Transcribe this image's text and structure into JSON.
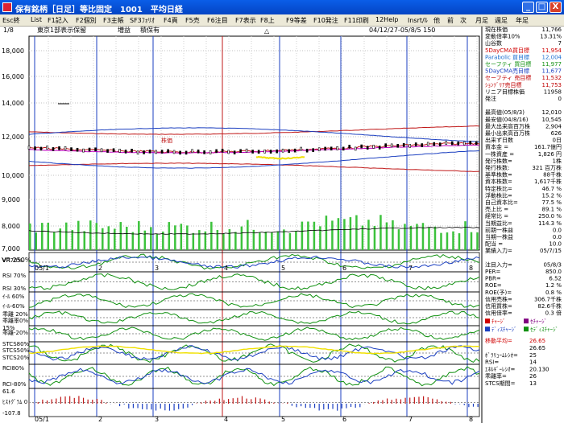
{
  "window": {
    "title": "保有銘柄［日足］等比固定　1001　平均日経",
    "minimize_label": "_",
    "maximize_label": "□",
    "close_label": "X"
  },
  "menu": [
    "Esc終",
    "List",
    "F1記入",
    "F2個別",
    "F3主帳",
    "SF3ﾌｫﾘｵ",
    "F4頁",
    "F5売",
    "F6注目",
    "F7表示",
    "F8上",
    "F9等差",
    "F10発注",
    "F11印刷",
    "12Help",
    "Insrt/ﾙ",
    "他",
    "前",
    "次",
    "月足",
    "週足",
    "年足"
  ],
  "header": {
    "page": "1/8",
    "section": "東京1部表示保留",
    "tag1": "増益",
    "tag2": "積保有",
    "marker": "△",
    "date_range": "04/12/27-05/8/5 150"
  },
  "price_axis": [
    "18,000",
    "16,000",
    "14,000",
    "12,000",
    "10,000",
    "9,000",
    "8,000",
    "7,000"
  ],
  "vr_label": "VR 250%",
  "x_labels": [
    "05/1",
    "2",
    "3",
    "4",
    "5",
    "6",
    "7",
    "8"
  ],
  "ma_label": "5DayCMA",
  "chart_annotation": "株価",
  "indicators": {
    "vr": "VR70%",
    "rsi": [
      "RSI 70%",
      "RSI 30%"
    ],
    "ie": [
      "ｲ-ﾙ 60%",
      "ｲ-ﾙ-60%"
    ],
    "kairi": [
      "乖離 20%",
      "乖離率0%"
    ],
    "kairi2": [
      "乖離-20%",
      "15%"
    ],
    "stcs": [
      "STCS80%",
      "STCS50%",
      "STCS20%"
    ],
    "rci": [
      "RCI80%",
      "RCI-80%"
    ],
    "hist": [
      "61.6",
      "ﾋｽﾄｸﾞﾗﾑ 0",
      "-107.8"
    ]
  },
  "info_panel": [
    {
      "label": "現在株価",
      "value": "11,766",
      "color": "#000000"
    },
    {
      "label": "変動倍率10%",
      "value": "13.31%",
      "color": "#000000"
    },
    {
      "label": "山谷数",
      "value": "7",
      "color": "#000000"
    },
    {
      "label": "5DayCMA買目標",
      "value": "11,954",
      "color": "#d00000"
    },
    {
      "label": "Parabolic 買目標",
      "value": "12,004",
      "color": "#1b6fd0"
    },
    {
      "label": "セーフティ 買目標",
      "value": "11,977",
      "color": "#109010"
    },
    {
      "label": "5DayCMA売目標",
      "value": "11,677",
      "color": "#1b3fc0"
    },
    {
      "label": "セーフティ 売目標",
      "value": "11,532",
      "color": "#c00000"
    },
    {
      "label": "ｼｮﾝﾃﾞﾘｱ売目標",
      "value": "11,753",
      "color": "#c00000"
    },
    {
      "label": "リニア目標株価",
      "value": "11958",
      "color": "#000000"
    },
    {
      "label": "発注",
      "value": "0",
      "color": "#000000"
    },
    {
      "label": "",
      "value": "",
      "color": "#000000"
    },
    {
      "label": "最高値(05/8/3)",
      "value": "12,010",
      "color": "#000000"
    },
    {
      "label": "最安値(04/8/16)",
      "value": "10,545",
      "color": "#000000"
    },
    {
      "label": "最大出来高百万株",
      "value": "2,904",
      "color": "#000000"
    },
    {
      "label": "最小出来高百万株",
      "value": "626",
      "color": "#000000"
    },
    {
      "label": "出来ず日数",
      "value": "0日",
      "color": "#000000"
    },
    {
      "label": "資本金 =",
      "value": "161.7億円",
      "color": "#000000"
    },
    {
      "label": "一株資産 =",
      "value": "1,826 円",
      "color": "#000000"
    },
    {
      "label": "発行株数=",
      "value": "1株",
      "color": "#000000"
    },
    {
      "label": "発行株数:",
      "value": "321 百万株",
      "color": "#000000"
    },
    {
      "label": "基準株数=",
      "value": "88千株",
      "color": "#000000"
    },
    {
      "label": "資本株数=",
      "value": "1,617千株",
      "color": "#000000"
    },
    {
      "label": "特定株比=",
      "value": "46.7 %",
      "color": "#000000"
    },
    {
      "label": "浮動株比=",
      "value": "15.2 %",
      "color": "#000000"
    },
    {
      "label": "自己資本比=",
      "value": "77.5 %",
      "color": "#000000"
    },
    {
      "label": "売上比 =",
      "value": "89.1 %",
      "color": "#000000"
    },
    {
      "label": "経常比 =",
      "value": "250.0 %",
      "color": "#000000"
    },
    {
      "label": "当期益比=",
      "value": "114.3 %",
      "color": "#000000"
    },
    {
      "label": "前期一株益",
      "value": "0.0",
      "color": "#000000"
    },
    {
      "label": "当期一株益",
      "value": "0.0",
      "color": "#000000"
    },
    {
      "label": "配当 =",
      "value": "10.0",
      "color": "#000000"
    },
    {
      "label": "業績入力=",
      "value": "05/7/15",
      "color": "#000000"
    },
    {
      "label": "",
      "value": "",
      "color": "#000000"
    },
    {
      "label": "注目入力=",
      "value": "05/8/3",
      "color": "#000000"
    },
    {
      "label": "PER=",
      "value": "850.0",
      "color": "#000000"
    },
    {
      "label": "PBR=",
      "value": "6.52",
      "color": "#000000"
    },
    {
      "label": "ROE=",
      "value": "1.2 %",
      "color": "#000000"
    },
    {
      "label": "ROE(予)=",
      "value": "0.8 %",
      "color": "#000000"
    },
    {
      "label": "信用売株=",
      "value": "306.7千株",
      "color": "#000000"
    },
    {
      "label": "信用買株=",
      "value": "82.6千株",
      "color": "#000000"
    },
    {
      "label": "信用倍率=",
      "value": "0.3 倍",
      "color": "#000000"
    }
  ],
  "legend": [
    {
      "label": "ﾁｬｰｼﾞ",
      "color": "#d00000"
    },
    {
      "label": "ｾﾁｬｰｼﾞ",
      "color": "#800080"
    },
    {
      "label": "ﾃﾞｨｽﾁｬｰｼﾞ",
      "color": "#1b3fc0"
    },
    {
      "label": "ｾﾃﾞｨｽﾁｬｰｼﾞ",
      "color": "#109010"
    }
  ],
  "bottom_panel": [
    {
      "label": "移動平均=",
      "value": "26.65",
      "color": "#d00000"
    },
    {
      "label": "",
      "value": "26.65",
      "color": "#000000"
    },
    {
      "label": "ﾎﾞﾗﾘｭｰﾑﾚｼｵ=",
      "value": "25",
      "color": "#000000"
    },
    {
      "label": "RSI=",
      "value": "14",
      "color": "#000000"
    },
    {
      "label": "ｴﾈﾙｷﾞｰﾚｼｵ=",
      "value": "20.130",
      "color": "#000000"
    },
    {
      "label": "乖離率=",
      "value": "26",
      "color": "#000000"
    },
    {
      "label": "STCS期間=",
      "value": "13",
      "color": "#000000"
    }
  ],
  "colors": {
    "titlebar": "#0a5ee8",
    "price_line": "#c01818",
    "channel": "#1b3fc0",
    "volume": "#3cc23c",
    "grid": "#b0b0b0"
  }
}
